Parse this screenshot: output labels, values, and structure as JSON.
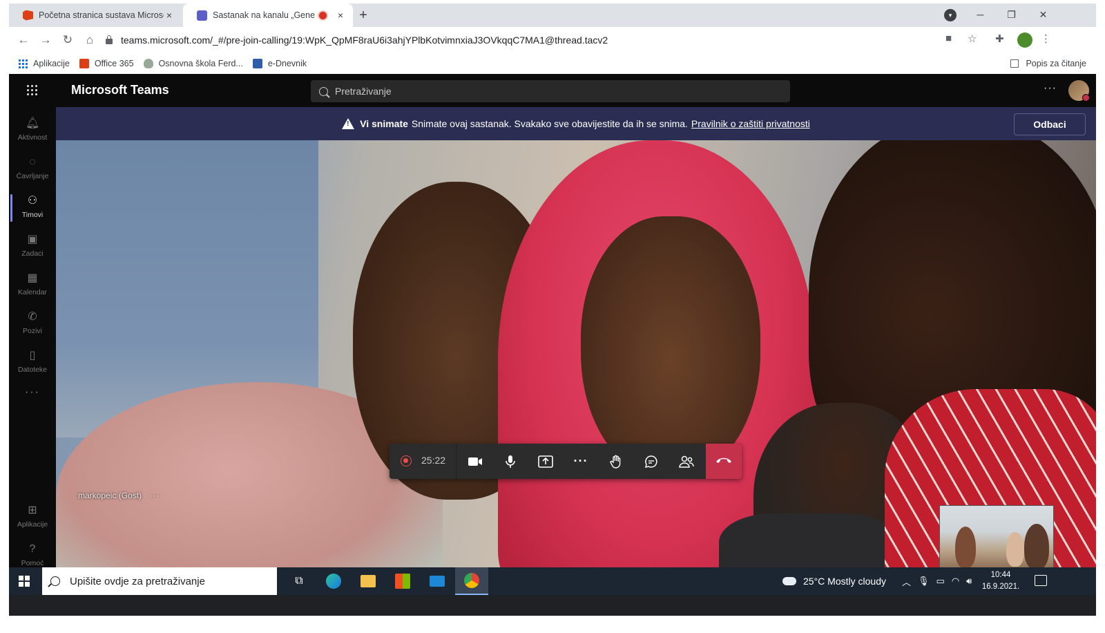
{
  "browser": {
    "tabs": [
      {
        "title": "Početna stranica sustava Microso",
        "close": "×"
      },
      {
        "title": "Sastanak na kanalu „General",
        "close": "×"
      }
    ],
    "new_tab": "+",
    "url": "teams.microsoft.com/_#/pre-join-calling/19:WpK_QpMF8raU6i3ahjYPlbKotvimnxiaJ3OVkqqC7MA1@thread.tacv2",
    "bookmarks": [
      {
        "label": "Aplikacije"
      },
      {
        "label": "Office 365"
      },
      {
        "label": "Osnovna škola Ferd..."
      },
      {
        "label": "e-Dnevnik"
      }
    ],
    "reading_list": "Popis za čitanje"
  },
  "teams": {
    "app_title": "Microsoft Teams",
    "search_placeholder": "Pretraživanje",
    "more": "···",
    "rail": [
      {
        "label": "Aktivnost",
        "icon": "bell-icon"
      },
      {
        "label": "Ćavrljanje",
        "icon": "chat-icon"
      },
      {
        "label": "Timovi",
        "icon": "teams-icon"
      },
      {
        "label": "Zadaci",
        "icon": "assignments-icon"
      },
      {
        "label": "Kalendar",
        "icon": "calendar-icon"
      },
      {
        "label": "Pozivi",
        "icon": "phone-icon"
      },
      {
        "label": "Datoteke",
        "icon": "file-icon"
      }
    ],
    "rail_more": "···",
    "rail_bottom": [
      {
        "label": "Aplikacije",
        "icon": "apps-icon"
      },
      {
        "label": "Pomoć",
        "icon": "help-icon"
      }
    ]
  },
  "banner": {
    "bold": "Vi snimate",
    "text": "Snimate ovaj sastanak. Svakako sve obavijestite da ih se snima.",
    "link": "Pravilnik o zaštiti privatnosti",
    "dismiss": "Odbaci"
  },
  "meeting": {
    "participant_name": "markopeic (Gost)",
    "participant_more": "···",
    "timer": "25:22",
    "more_actions": "···"
  },
  "taskbar": {
    "search_placeholder": "Upišite ovdje za pretraživanje",
    "weather": "25°C  Mostly cloudy",
    "time": "10:44",
    "date": "16.9.2021."
  },
  "colors": {
    "teams_banner": "#2b2e52",
    "hangup": "#c4314b",
    "recording": "#e64d4d",
    "taskbar": "#1c2532"
  }
}
